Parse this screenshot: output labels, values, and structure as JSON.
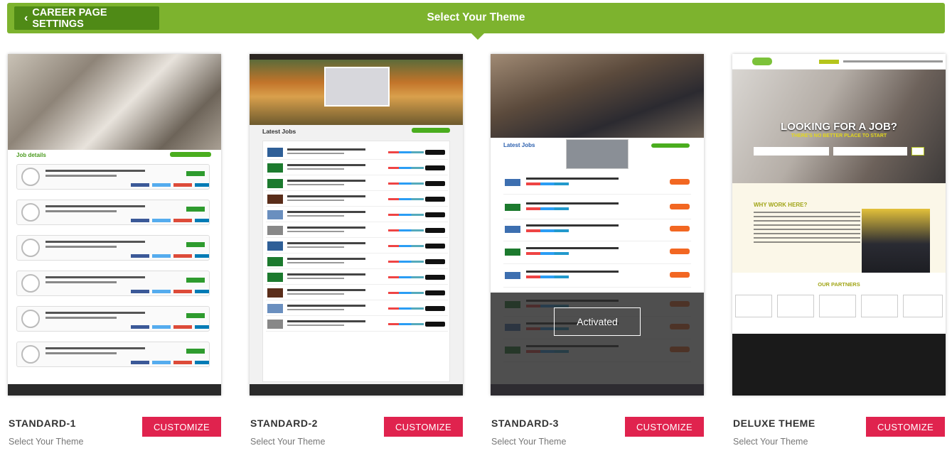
{
  "header": {
    "back_label": "CAREER PAGE SETTINGS",
    "title": "Select Your Theme",
    "accent_color": "#7db32e"
  },
  "icons": {
    "back": "chevron-left-icon"
  },
  "themes": [
    {
      "name": "STANDARD-1",
      "subtitle": "Select Your Theme",
      "button": "CUSTOMIZE",
      "preview_heading": "Job details"
    },
    {
      "name": "STANDARD-2",
      "subtitle": "Select Your Theme",
      "button": "CUSTOMIZE",
      "preview_heading": "Latest Jobs"
    },
    {
      "name": "STANDARD-3",
      "subtitle": "Select Your Theme",
      "button": "CUSTOMIZE",
      "preview_heading": "Latest Jobs",
      "status": "Activated"
    },
    {
      "name": "DELUXE THEME",
      "subtitle": "Select Your Theme",
      "button": "CUSTOMIZE",
      "preview_heading": "LOOKING FOR A JOB?",
      "preview_sub": "THERE'S NO BETTER PLACE TO START",
      "why": "WHY WORK HERE?",
      "partners": "OUR PARTNERS"
    }
  ],
  "customize_color": "#e0234e"
}
